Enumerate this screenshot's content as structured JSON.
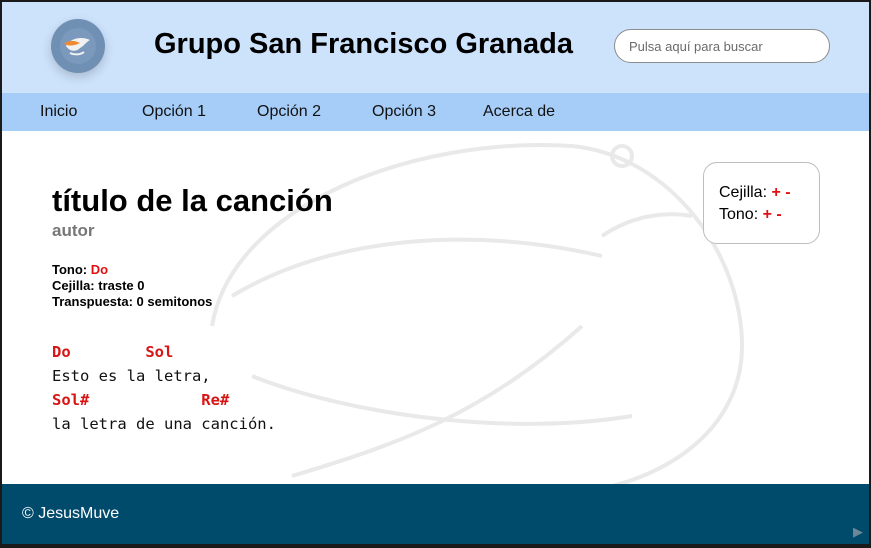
{
  "header": {
    "site_title": "Grupo San Francisco Granada",
    "search_placeholder": "Pulsa aquí para buscar",
    "logo_icon": "dove-icon"
  },
  "nav": {
    "items": [
      {
        "label": "Inicio"
      },
      {
        "label": "Opción 1"
      },
      {
        "label": "Opción 2"
      },
      {
        "label": "Opción 3"
      },
      {
        "label": "Acerca de"
      }
    ]
  },
  "song": {
    "title": "título de la canción",
    "author": "autor",
    "tone_label": "Tono:",
    "tone_value": "Do",
    "capo_text": "Cejilla: traste 0",
    "transpose_text": "Transpuesta: 0 semitonos",
    "lines": [
      {
        "type": "chord",
        "text": "Do        Sol"
      },
      {
        "type": "lyric",
        "text": "Esto es la letra,"
      },
      {
        "type": "chord",
        "text": "Sol#            Re#"
      },
      {
        "type": "lyric",
        "text": "la letra de una canción."
      }
    ]
  },
  "controls": {
    "capo_label": "Cejilla:",
    "tone_label": "Tono:",
    "plus": "+",
    "minus": "-"
  },
  "footer": {
    "copyright": "© JesusMuve"
  },
  "colors": {
    "header_bg": "#cde2fb",
    "nav_bg": "#a6cdf8",
    "footer_bg": "#004a6c",
    "chord": "#d81414"
  }
}
